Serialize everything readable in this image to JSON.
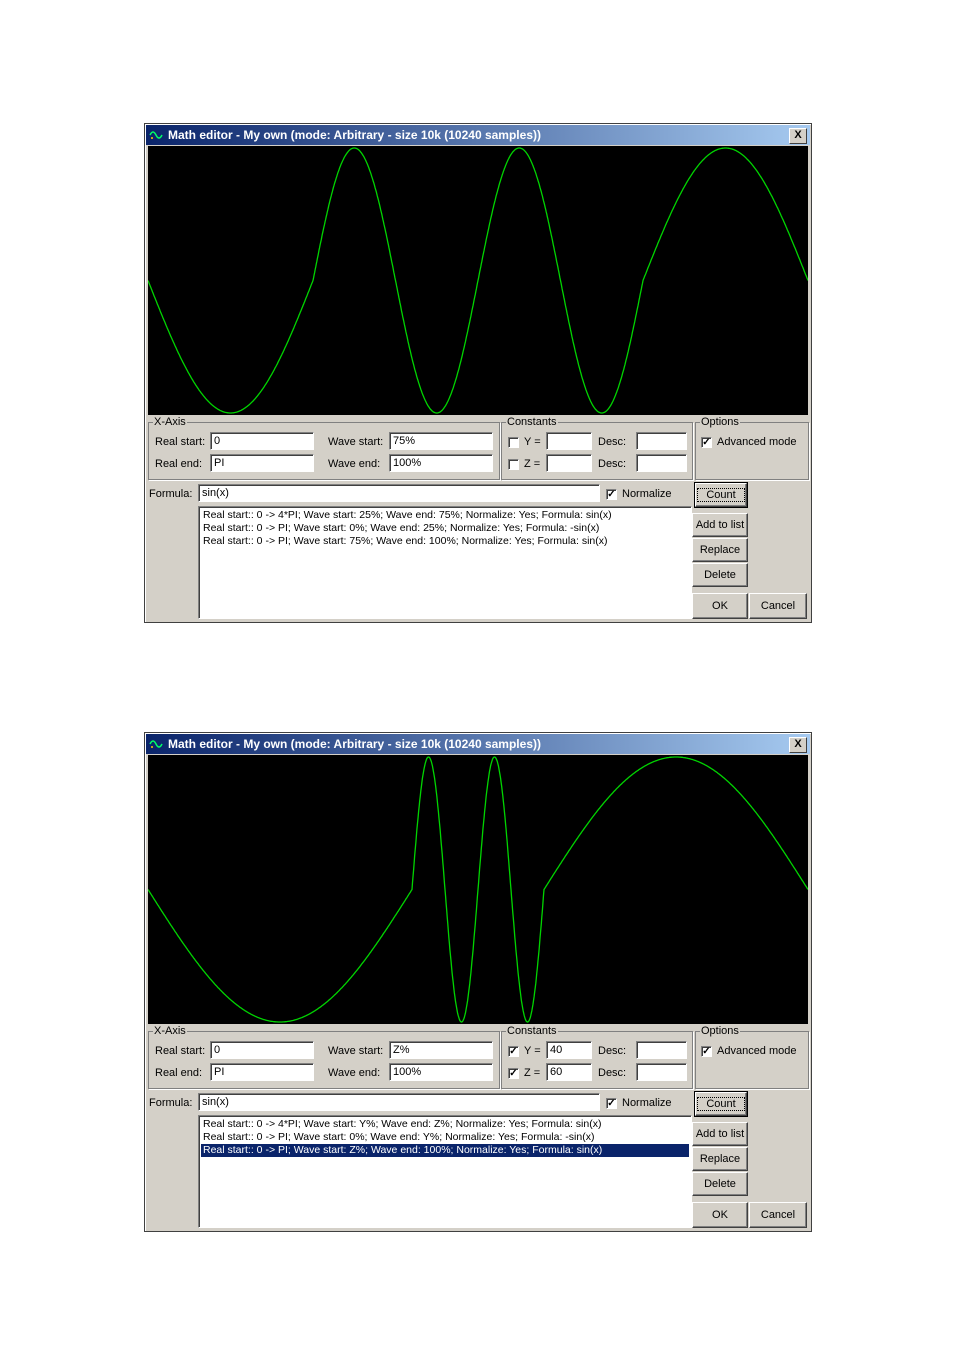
{
  "windows": [
    {
      "title": "Math editor - My own (mode: Arbitrary - size 10k (10240 samples))",
      "close_label": "X",
      "x_axis": {
        "label": "X-Axis",
        "real_start_label": "Real start:",
        "real_start": "0",
        "real_end_label": "Real end:",
        "real_end": "PI",
        "wave_start_label": "Wave start:",
        "wave_start": "75%",
        "wave_end_label": "Wave end:",
        "wave_end": "100%"
      },
      "constants": {
        "label": "Constants",
        "y_label": "Y =",
        "y_checked": false,
        "y_value": "",
        "z_label": "Z =",
        "z_checked": false,
        "z_value": "",
        "desc_label": "Desc:"
      },
      "options": {
        "label": "Options",
        "advanced_label": "Advanced mode",
        "advanced_checked": true
      },
      "formula_label": "Formula:",
      "formula": "sin(x)",
      "normalize_label": "Normalize",
      "normalize_checked": true,
      "buttons": {
        "count": "Count",
        "add": "Add to list",
        "replace": "Replace",
        "delete": "Delete",
        "ok": "OK",
        "cancel": "Cancel"
      },
      "list": [
        "Real start:: 0 -> 4*PI; Wave start: 25%; Wave end: 75%; Normalize: Yes; Formula: sin(x)",
        "Real start:: 0 -> PI; Wave start: 0%; Wave end: 25%; Normalize: Yes; Formula: -sin(x)",
        "Real start:: 0 -> PI; Wave start: 75%; Wave end: 100%; Normalize: Yes; Formula: sin(x)"
      ],
      "selected_index": -1,
      "waveform": {
        "color": "#00d400",
        "segments": [
          {
            "wave_start": 0,
            "wave_end": 25,
            "formula": "-sin(x)",
            "real_start": 0,
            "real_end": "PI"
          },
          {
            "wave_start": 25,
            "wave_end": 75,
            "formula": "sin(x)",
            "real_start": 0,
            "real_end": "4*PI"
          },
          {
            "wave_start": 75,
            "wave_end": 100,
            "formula": "sin(x)",
            "real_start": 0,
            "real_end": "PI"
          }
        ]
      }
    },
    {
      "title": "Math editor - My own (mode: Arbitrary - size 10k (10240 samples))",
      "close_label": "X",
      "x_axis": {
        "label": "X-Axis",
        "real_start_label": "Real start:",
        "real_start": "0",
        "real_end_label": "Real end:",
        "real_end": "PI",
        "wave_start_label": "Wave start:",
        "wave_start": "Z%",
        "wave_end_label": "Wave end:",
        "wave_end": "100%"
      },
      "constants": {
        "label": "Constants",
        "y_label": "Y =",
        "y_checked": true,
        "y_value": "40",
        "z_label": "Z =",
        "z_checked": true,
        "z_value": "60",
        "desc_label": "Desc:"
      },
      "options": {
        "label": "Options",
        "advanced_label": "Advanced mode",
        "advanced_checked": true
      },
      "formula_label": "Formula:",
      "formula": "sin(x)",
      "normalize_label": "Normalize",
      "normalize_checked": true,
      "buttons": {
        "count": "Count",
        "add": "Add to list",
        "replace": "Replace",
        "delete": "Delete",
        "ok": "OK",
        "cancel": "Cancel"
      },
      "list": [
        "Real start:: 0 -> 4*PI; Wave start: Y%; Wave end: Z%; Normalize: Yes; Formula: sin(x)",
        "Real start:: 0 -> PI; Wave start: 0%; Wave end: Y%; Normalize: Yes; Formula: -sin(x)",
        "Real start:: 0 -> PI; Wave start: Z%; Wave end: 100%; Normalize: Yes; Formula: sin(x)"
      ],
      "selected_index": 2,
      "waveform": {
        "color": "#00d400",
        "segments": [
          {
            "wave_start": 0,
            "wave_end": 40,
            "formula": "-sin(x)",
            "real_start": 0,
            "real_end": "PI"
          },
          {
            "wave_start": 40,
            "wave_end": 60,
            "formula": "sin(x)",
            "real_start": 0,
            "real_end": "4*PI"
          },
          {
            "wave_start": 60,
            "wave_end": 100,
            "formula": "sin(x)",
            "real_start": 0,
            "real_end": "PI"
          }
        ]
      }
    }
  ]
}
